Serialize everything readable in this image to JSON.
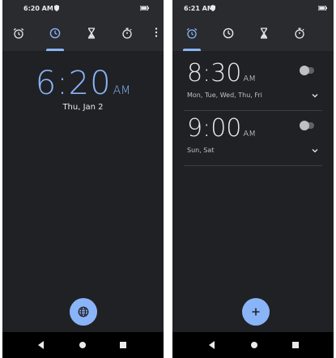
{
  "left": {
    "status_time": "6:20 AM",
    "clock_time": "6:20",
    "clock_ampm": "AM",
    "clock_date": "Thu, Jan 2"
  },
  "right": {
    "status_time": "6:21 AM",
    "alarms": [
      {
        "time": "8:30",
        "ampm": "AM",
        "days": "Mon, Tue, Wed, Thu, Fri",
        "enabled": false
      },
      {
        "time": "9:00",
        "ampm": "AM",
        "days": "Sun, Sat",
        "enabled": false
      }
    ]
  },
  "icons": {
    "tabs": [
      "alarm-icon",
      "clock-icon",
      "timer-icon",
      "stopwatch-icon"
    ],
    "overflow": "more-vert-icon",
    "fab_left": "globe-icon",
    "fab_right": "add-icon"
  },
  "colors": {
    "background": "#202124",
    "appbar": "#2a2b2e",
    "accent": "#8ab4f8",
    "text": "#e8eaed",
    "inactive_icon": "#e8eaed"
  }
}
